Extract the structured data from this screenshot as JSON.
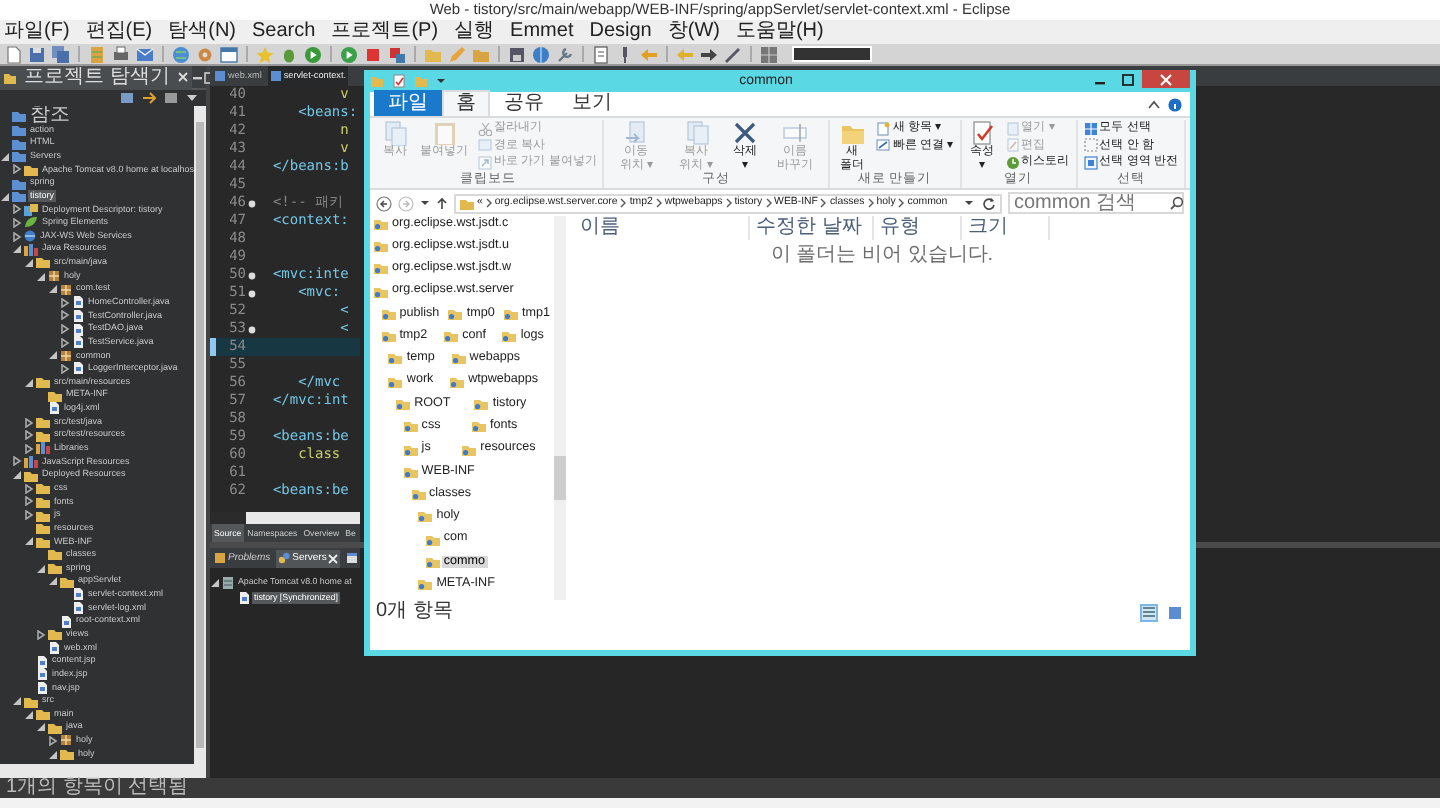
{
  "window": {
    "title": "Web - tistory/src/main/webapp/WEB-INF/spring/appServlet/servlet-context.xml - Eclipse"
  },
  "menu": [
    "파일(F)",
    "편집(E)",
    "탐색(N)",
    "Search",
    "프로젝트(P)",
    "실행",
    "Emmet",
    "Design",
    "창(W)",
    "도움말(H)"
  ],
  "project_explorer": {
    "title": "프로젝트 탐색기",
    "tree": [
      {
        "label": "참조",
        "kind": "project",
        "selected": false
      },
      {
        "label": "action",
        "kind": "project",
        "selected": false
      },
      {
        "label": "HTML",
        "kind": "project",
        "selected": false
      },
      {
        "label": "Servers",
        "kind": "project",
        "expanded": true,
        "selected": false,
        "children": [
          {
            "label": "Apache Tomcat v8.0 home at localhos",
            "kind": "folder",
            "expanded": false,
            "selected": false
          }
        ]
      },
      {
        "label": "spring",
        "kind": "project",
        "selected": false
      },
      {
        "label": "tistory",
        "kind": "project",
        "expanded": true,
        "selected": true,
        "children": [
          {
            "label": "Deployment Descriptor: tistory",
            "kind": "descriptor",
            "expanded": false,
            "selected": false
          },
          {
            "label": "Spring Elements",
            "kind": "leaf",
            "expanded": false,
            "selected": false
          },
          {
            "label": "JAX-WS Web Services",
            "kind": "globe",
            "expanded": false,
            "selected": false
          },
          {
            "label": "Java Resources",
            "kind": "library",
            "expanded": true,
            "selected": false,
            "children": [
              {
                "label": "src/main/java",
                "kind": "folder",
                "expanded": true,
                "selected": false,
                "children": [
                  {
                    "label": "holy",
                    "kind": "package",
                    "expanded": true,
                    "selected": false,
                    "children": [
                      {
                        "label": "com.test",
                        "kind": "package",
                        "expanded": true,
                        "selected": false,
                        "children": [
                          {
                            "label": "HomeController.java",
                            "kind": "file",
                            "expanded": false,
                            "selected": false
                          },
                          {
                            "label": "TestController.java",
                            "kind": "file",
                            "expanded": false,
                            "selected": false
                          },
                          {
                            "label": "TestDAO.java",
                            "kind": "file",
                            "expanded": false,
                            "selected": false
                          },
                          {
                            "label": "TestService.java",
                            "kind": "file",
                            "expanded": false,
                            "selected": false
                          }
                        ]
                      },
                      {
                        "label": "common",
                        "kind": "package",
                        "expanded": true,
                        "selected": false,
                        "children": [
                          {
                            "label": "LoggerInterceptor.java",
                            "kind": "file",
                            "expanded": false,
                            "selected": false
                          }
                        ]
                      }
                    ]
                  }
                ]
              },
              {
                "label": "src/main/resources",
                "kind": "folder",
                "expanded": true,
                "selected": false,
                "children": [
                  {
                    "label": "META-INF",
                    "kind": "folder",
                    "selected": false
                  },
                  {
                    "label": "log4j.xml",
                    "kind": "file",
                    "selected": false
                  }
                ]
              },
              {
                "label": "src/test/java",
                "kind": "folder",
                "expanded": false,
                "selected": false
              },
              {
                "label": "src/test/resources",
                "kind": "folder",
                "expanded": false,
                "selected": false
              },
              {
                "label": "Libraries",
                "kind": "library",
                "expanded": false,
                "selected": false
              }
            ]
          },
          {
            "label": "JavaScript Resources",
            "kind": "library",
            "expanded": false,
            "selected": false
          },
          {
            "label": "Deployed Resources",
            "kind": "folder",
            "expanded": true,
            "selected": false,
            "children": [
              {
                "label": "css",
                "kind": "folder",
                "expanded": false,
                "selected": false
              },
              {
                "label": "fonts",
                "kind": "folder",
                "expanded": false,
                "selected": false
              },
              {
                "label": "js",
                "kind": "folder",
                "expanded": false,
                "selected": false
              },
              {
                "label": "resources",
                "kind": "folder",
                "selected": false
              },
              {
                "label": "WEB-INF",
                "kind": "folder",
                "expanded": true,
                "selected": false,
                "children": [
                  {
                    "label": "classes",
                    "kind": "folder",
                    "selected": false
                  },
                  {
                    "label": "spring",
                    "kind": "folder",
                    "expanded": true,
                    "selected": false,
                    "children": [
                      {
                        "label": "appServlet",
                        "kind": "folder",
                        "expanded": true,
                        "selected": false,
                        "children": [
                          {
                            "label": "servlet-context.xml",
                            "kind": "file",
                            "selected": false
                          },
                          {
                            "label": "servlet-log.xml",
                            "kind": "file",
                            "selected": false
                          }
                        ]
                      },
                      {
                        "label": "root-context.xml",
                        "kind": "file",
                        "selected": false
                      }
                    ]
                  },
                  {
                    "label": "views",
                    "kind": "folder",
                    "expanded": false,
                    "selected": false
                  },
                  {
                    "label": "web.xml",
                    "kind": "file",
                    "selected": false
                  }
                ]
              },
              {
                "label": "content.jsp",
                "kind": "file",
                "selected": false
              },
              {
                "label": "index.jsp",
                "kind": "file",
                "selected": false
              },
              {
                "label": "nav.jsp",
                "kind": "file",
                "selected": false
              }
            ]
          },
          {
            "label": "src",
            "kind": "folder",
            "expanded": true,
            "selected": false,
            "children": [
              {
                "label": "main",
                "kind": "folder",
                "expanded": true,
                "selected": false,
                "children": [
                  {
                    "label": "java",
                    "kind": "folder",
                    "expanded": true,
                    "selected": false,
                    "children": [
                      {
                        "label": "holy",
                        "kind": "package",
                        "expanded": false,
                        "selected": false
                      },
                      {
                        "label": "holy",
                        "kind": "folder",
                        "expanded": true,
                        "selected": false
                      }
                    ]
                  }
                ]
              }
            ]
          }
        ]
      }
    ]
  },
  "editor": {
    "tabs": [
      {
        "label": "web.xml",
        "selected": false
      },
      {
        "label": "servlet-context.",
        "selected": true
      }
    ],
    "lines": [
      {
        "number": "40",
        "code": "          v",
        "kind": "attr",
        "fold": false,
        "current": false
      },
      {
        "number": "41",
        "code": "     <beans:",
        "kind": "tag",
        "fold": false,
        "current": false
      },
      {
        "number": "42",
        "code": "          n",
        "kind": "attr",
        "fold": false,
        "current": false
      },
      {
        "number": "43",
        "code": "          v",
        "kind": "attr",
        "fold": false,
        "current": false
      },
      {
        "number": "44",
        "code": "  </beans:b",
        "kind": "tag",
        "fold": false,
        "current": false
      },
      {
        "number": "45",
        "fold": false,
        "current": false
      },
      {
        "number": "46",
        "code": "  <!-- 패키",
        "kind": "comment",
        "fold": true,
        "current": false
      },
      {
        "number": "47",
        "code": "  <context:",
        "kind": "tag",
        "fold": false,
        "current": false
      },
      {
        "number": "48",
        "fold": false,
        "current": false
      },
      {
        "number": "49",
        "fold": false,
        "current": false
      },
      {
        "number": "50",
        "code": "  <mvc:inte",
        "kind": "tag",
        "fold": true,
        "current": false
      },
      {
        "number": "51",
        "code": "     <mvc:",
        "kind": "tag",
        "fold": true,
        "current": false
      },
      {
        "number": "52",
        "code": "          <",
        "kind": "tag",
        "fold": false,
        "current": false
      },
      {
        "number": "53",
        "code": "          <",
        "kind": "tag",
        "fold": true,
        "current": false
      },
      {
        "number": "54",
        "fold": false,
        "current": true
      },
      {
        "number": "55",
        "fold": false,
        "current": false
      },
      {
        "number": "56",
        "code": "     </mvc",
        "kind": "tag",
        "fold": false,
        "current": false
      },
      {
        "number": "57",
        "code": "  </mvc:int",
        "kind": "tag",
        "fold": false,
        "current": false
      },
      {
        "number": "58",
        "fold": false,
        "current": false
      },
      {
        "number": "59",
        "code": "  <beans:be",
        "kind": "tag",
        "fold": false,
        "current": false
      },
      {
        "number": "60",
        "code": "     class",
        "kind": "attr",
        "fold": false,
        "current": false
      },
      {
        "number": "61",
        "fold": false,
        "current": false
      },
      {
        "number": "62",
        "code": "  <beans:be",
        "kind": "tag",
        "fold": false,
        "current": false
      }
    ],
    "bottom_tabs": [
      {
        "label": "Source",
        "selected": true
      },
      {
        "label": "Namespaces",
        "selected": false
      },
      {
        "label": "Overview",
        "selected": false
      },
      {
        "label": "Be",
        "selected": false
      }
    ]
  },
  "bottom_panel": {
    "tabs": [
      {
        "label": "Problems",
        "selected": false
      },
      {
        "label": "Servers",
        "selected": true
      },
      {
        "selected": false
      }
    ],
    "tree": [
      {
        "label": "Apache Tomcat v8.0 home at",
        "kind": "server",
        "expanded": true,
        "selected": false,
        "children": [
          {
            "label": "tistory  [Synchronized]",
            "kind": "file",
            "selected": true
          }
        ]
      }
    ]
  },
  "file_explorer": {
    "title": "common",
    "ribbon_tabs": [
      {
        "label": "파일",
        "kind": "file",
        "selected": false
      },
      {
        "label": "홈",
        "kind": "tab",
        "selected": true
      },
      {
        "label": "공유",
        "kind": "tab",
        "selected": false
      },
      {
        "label": "보기",
        "kind": "tab",
        "selected": false
      }
    ],
    "ribbon_groups": [
      {
        "label": "클립보드",
        "items": [
          {
            "label": "복사",
            "kind": "large",
            "disabled": true
          },
          {
            "label": "붙여넣기",
            "kind": "large",
            "disabled": true
          },
          {
            "label": "잘라내기",
            "kind": "small",
            "disabled": true
          },
          {
            "label": "경로 복사",
            "kind": "small",
            "disabled": true
          },
          {
            "label": "바로 가기 붙여넣기",
            "kind": "small",
            "disabled": true
          }
        ]
      },
      {
        "label": "구성",
        "items": [
          {
            "label": "이동 위치 ▾",
            "kind": "large",
            "disabled": true
          },
          {
            "label": "복사 위치 ▾",
            "kind": "large",
            "disabled": true
          },
          {
            "label": "삭제 ▾",
            "kind": "large",
            "disabled": false
          },
          {
            "label": "이름 바꾸기",
            "kind": "large",
            "disabled": true
          }
        ]
      },
      {
        "label": "새로 만들기",
        "items": [
          {
            "label": "새 폴더",
            "kind": "large",
            "disabled": false
          },
          {
            "label": "새 항목 ▾",
            "kind": "small",
            "disabled": false
          },
          {
            "label": "빠른 연결 ▾",
            "kind": "small",
            "disabled": false
          }
        ]
      },
      {
        "label": "열기",
        "items": [
          {
            "label": "속성 ▾",
            "kind": "large",
            "disabled": false
          },
          {
            "label": "열기 ▾",
            "kind": "small",
            "disabled": true
          },
          {
            "label": "편집",
            "kind": "small",
            "disabled": true
          },
          {
            "label": "히스토리",
            "kind": "small",
            "disabled": false
          }
        ]
      },
      {
        "label": "선택",
        "items": [
          {
            "label": "모두 선택",
            "kind": "small",
            "disabled": false
          },
          {
            "label": "선택 안 함",
            "kind": "small",
            "disabled": false
          },
          {
            "label": "선택 영역 반전",
            "kind": "small",
            "disabled": false
          }
        ]
      }
    ],
    "address": {
      "overflow": "«",
      "crumbs": [
        "org.eclipse.wst.server.core",
        "tmp2",
        "wtpwebapps",
        "tistory",
        "WEB-INF",
        "classes",
        "holy",
        "common"
      ]
    },
    "search": {
      "placeholder": "common 검색"
    },
    "nav_tree": [
      {
        "label": "org.eclipse.wst.jsdt.c",
        "selected": false
      },
      {
        "label": "org.eclipse.wst.jsdt.u",
        "selected": false
      },
      {
        "label": "org.eclipse.wst.jsdt.w",
        "selected": false
      },
      {
        "label": "org.eclipse.wst.server",
        "selected": false,
        "children": [
          {
            "label": "publish",
            "selected": false
          },
          {
            "label": "tmp0",
            "selected": false
          },
          {
            "label": "tmp1",
            "selected": false
          },
          {
            "label": "tmp2",
            "selected": false,
            "children": [
              {
                "label": "conf",
                "selected": false
              },
              {
                "label": "logs",
                "selected": false
              },
              {
                "label": "temp",
                "selected": false
              },
              {
                "label": "webapps",
                "selected": false
              },
              {
                "label": "work",
                "selected": false
              },
              {
                "label": "wtpwebapps",
                "selected": false,
                "children": [
                  {
                    "label": "ROOT",
                    "selected": false
                  },
                  {
                    "label": "tistory",
                    "selected": false,
                    "children": [
                      {
                        "label": "css",
                        "selected": false
                      },
                      {
                        "label": "fonts",
                        "selected": false
                      },
                      {
                        "label": "js",
                        "selected": false
                      },
                      {
                        "label": "resources",
                        "selected": false
                      },
                      {
                        "label": "WEB-INF",
                        "selected": false,
                        "children": [
                          {
                            "label": "classes",
                            "selected": false,
                            "children": [
                              {
                                "label": "holy",
                                "selected": false,
                                "children": [
                                  {
                                    "label": "com",
                                    "selected": false
                                  },
                                  {
                                    "label": "commo",
                                    "selected": true
                                  }
                                ]
                              },
                              {
                                "label": "META-INF",
                                "selected": false
                              }
                            ]
                          }
                        ]
                      }
                    ]
                  }
                ]
              }
            ]
          }
        ]
      }
    ],
    "columns": [
      "이름",
      "수정한 날짜",
      "유형",
      "크기"
    ],
    "empty_message": "이 폴더는 비어 있습니다.",
    "status": "0개 항목",
    "views": [
      {
        "kind": "details",
        "selected": true
      },
      {
        "kind": "large-icons",
        "selected": false
      }
    ]
  },
  "status_bar": "1개의 항목이 선택됨"
}
